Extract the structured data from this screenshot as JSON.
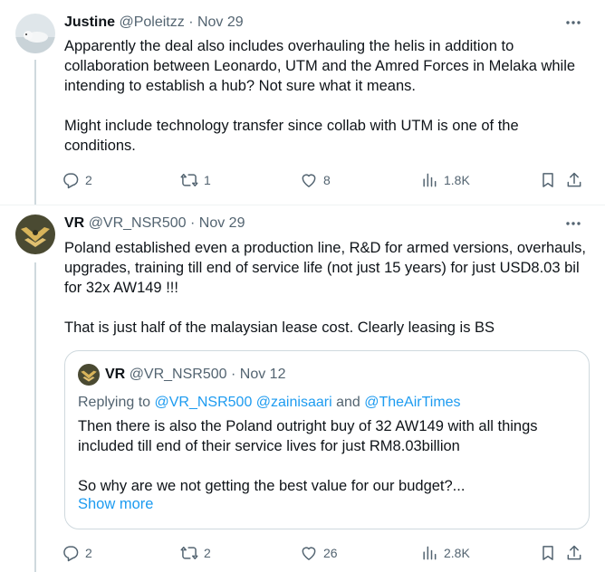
{
  "tweets": [
    {
      "author": {
        "name": "Justine",
        "handle": "@Poleitzz"
      },
      "date": "Nov 29",
      "separator": "·",
      "paragraphs": [
        "Apparently the deal also includes overhauling the helis in addition to collaboration between Leonardo, UTM and the Amred Forces in Melaka while intending to establish a hub? Not sure what it means.",
        "Might include technology transfer since collab with UTM is one of the conditions."
      ],
      "metrics": {
        "replies": "2",
        "reposts": "1",
        "likes": "8",
        "views": "1.8K"
      }
    },
    {
      "author": {
        "name": "VR",
        "handle": "@VR_NSR500"
      },
      "date": "Nov 29",
      "separator": "·",
      "paragraphs": [
        "Poland established even a production line, R&D for armed versions, overhauls, upgrades, training till end of service life (not just 15 years) for just USD8.03 bil for 32x AW149 !!!",
        "That is just half of the malaysian lease cost. Clearly leasing is BS"
      ],
      "quote": {
        "author": {
          "name": "VR",
          "handle": "@VR_NSR500"
        },
        "date": "Nov 12",
        "separator": "·",
        "replying_prefix": "Replying to ",
        "mention1": "@VR_NSR500 @zainisaari",
        "replying_and": " and ",
        "mention2": "@TheAirTimes",
        "paragraphs": [
          "Then there is also the Poland outright buy of 32 AW149 with all things included till end of their service lives for just RM8.03billion",
          "So why are we not getting the best value for our budget?..."
        ],
        "show_more": "Show more"
      },
      "metrics": {
        "replies": "2",
        "reposts": "2",
        "likes": "26",
        "views": "2.8K"
      }
    }
  ],
  "colors": {
    "text": "#0f1419",
    "secondary": "#536471",
    "link": "#1d9bf0",
    "border": "#cfd9de"
  }
}
